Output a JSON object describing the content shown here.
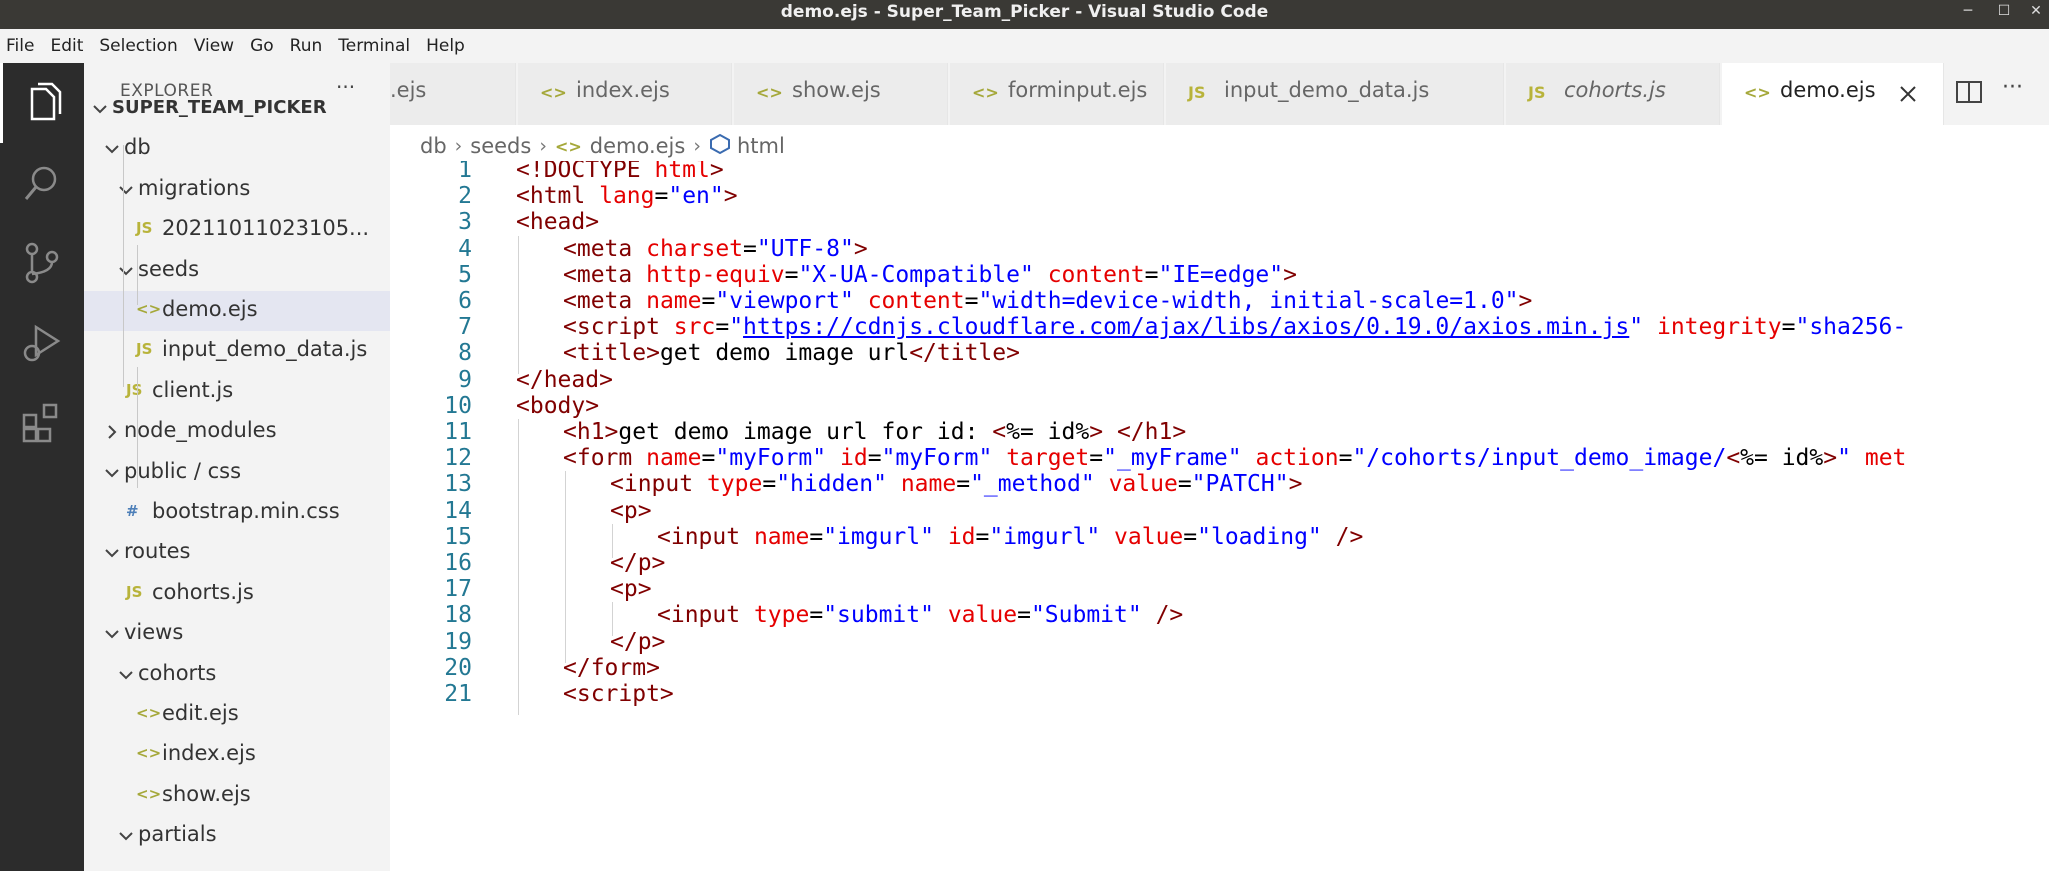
{
  "window": {
    "title": "demo.ejs - Super_Team_Picker - Visual Studio Code"
  },
  "menu": [
    "File",
    "Edit",
    "Selection",
    "View",
    "Go",
    "Run",
    "Terminal",
    "Help"
  ],
  "activity": [
    {
      "name": "explorer-icon"
    },
    {
      "name": "search-icon"
    },
    {
      "name": "source-control-icon"
    },
    {
      "name": "run-debug-icon"
    },
    {
      "name": "extensions-icon"
    }
  ],
  "explorer": {
    "title": "EXPLORER",
    "more": "···",
    "tree": [
      {
        "label": "SUPER_TEAM_PICKER",
        "kind": "root",
        "depth": 0,
        "open": true
      },
      {
        "label": "db",
        "kind": "folder",
        "depth": 1,
        "open": true
      },
      {
        "label": "migrations",
        "kind": "folder",
        "depth": 2,
        "open": true
      },
      {
        "label": "20211011023105...",
        "kind": "js",
        "depth": 3
      },
      {
        "label": "seeds",
        "kind": "folder",
        "depth": 2,
        "open": true
      },
      {
        "label": "demo.ejs",
        "kind": "ejs",
        "depth": 3,
        "selected": true
      },
      {
        "label": "input_demo_data.js",
        "kind": "js",
        "depth": 3
      },
      {
        "label": "client.js",
        "kind": "js",
        "depth": 2
      },
      {
        "label": "node_modules",
        "kind": "folder",
        "depth": 1,
        "open": false
      },
      {
        "label": "public / css",
        "kind": "folder",
        "depth": 1,
        "open": true
      },
      {
        "label": "bootstrap.min.css",
        "kind": "css",
        "depth": 2
      },
      {
        "label": "routes",
        "kind": "folder",
        "depth": 1,
        "open": true
      },
      {
        "label": "cohorts.js",
        "kind": "js",
        "depth": 2
      },
      {
        "label": "views",
        "kind": "folder",
        "depth": 1,
        "open": true
      },
      {
        "label": "cohorts",
        "kind": "folder",
        "depth": 2,
        "open": true
      },
      {
        "label": "edit.ejs",
        "kind": "ejs",
        "depth": 3
      },
      {
        "label": "index.ejs",
        "kind": "ejs",
        "depth": 3
      },
      {
        "label": "show.ejs",
        "kind": "ejs",
        "depth": 3
      },
      {
        "label": "partials",
        "kind": "folder",
        "depth": 2,
        "open": true
      }
    ]
  },
  "tabs": [
    {
      "label": ".ejs",
      "kind": "none"
    },
    {
      "label": "index.ejs",
      "kind": "ejs"
    },
    {
      "label": "show.ejs",
      "kind": "ejs"
    },
    {
      "label": "forminput.ejs",
      "kind": "ejs"
    },
    {
      "label": "input_demo_data.js",
      "kind": "js"
    },
    {
      "label": "cohorts.js",
      "kind": "js",
      "italic": true
    },
    {
      "label": "demo.ejs",
      "kind": "ejs",
      "active": true
    }
  ],
  "icon_glyphs": {
    "js": "JS",
    "ejs": "<>",
    "css": "#"
  },
  "breadcrumb": [
    "db",
    "seeds",
    "demo.ejs",
    "html"
  ],
  "code": [
    {
      "n": "1",
      "indent": 0,
      "t": [
        [
          "tag",
          "<!DOCTYPE "
        ],
        [
          "attr",
          "html"
        ],
        [
          "tag",
          ">"
        ]
      ]
    },
    {
      "n": "2",
      "indent": 0,
      "t": [
        [
          "tag",
          "<html "
        ],
        [
          "attr",
          "lang"
        ],
        [
          "txt",
          "="
        ],
        [
          "str",
          "\"en\""
        ],
        [
          "tag",
          ">"
        ]
      ]
    },
    {
      "n": "3",
      "indent": 0,
      "t": [
        [
          "tag",
          "<head>"
        ]
      ]
    },
    {
      "n": "4",
      "indent": 1,
      "t": [
        [
          "tag",
          "<meta "
        ],
        [
          "attr",
          "charset"
        ],
        [
          "txt",
          "="
        ],
        [
          "str",
          "\"UTF-8\""
        ],
        [
          "tag",
          ">"
        ]
      ]
    },
    {
      "n": "5",
      "indent": 1,
      "t": [
        [
          "tag",
          "<meta "
        ],
        [
          "attr",
          "http-equiv"
        ],
        [
          "txt",
          "="
        ],
        [
          "str",
          "\"X-UA-Compatible\""
        ],
        [
          "txt",
          " "
        ],
        [
          "attr",
          "content"
        ],
        [
          "txt",
          "="
        ],
        [
          "str",
          "\"IE=edge\""
        ],
        [
          "tag",
          ">"
        ]
      ]
    },
    {
      "n": "6",
      "indent": 1,
      "t": [
        [
          "tag",
          "<meta "
        ],
        [
          "attr",
          "name"
        ],
        [
          "txt",
          "="
        ],
        [
          "str",
          "\"viewport\""
        ],
        [
          "txt",
          " "
        ],
        [
          "attr",
          "content"
        ],
        [
          "txt",
          "="
        ],
        [
          "str",
          "\"width=device-width, initial-scale=1.0\""
        ],
        [
          "tag",
          ">"
        ]
      ]
    },
    {
      "n": "7",
      "indent": 1,
      "t": [
        [
          "tag",
          "<script "
        ],
        [
          "attr",
          "src"
        ],
        [
          "txt",
          "="
        ],
        [
          "str",
          "\""
        ],
        [
          "link",
          "https://cdnjs.cloudflare.com/ajax/libs/axios/0.19.0/axios.min.js"
        ],
        [
          "str",
          "\""
        ],
        [
          "txt",
          " "
        ],
        [
          "attr",
          "integrity"
        ],
        [
          "txt",
          "="
        ],
        [
          "str",
          "\"sha256-"
        ]
      ]
    },
    {
      "n": "8",
      "indent": 1,
      "t": [
        [
          "tag",
          "<title>"
        ],
        [
          "txt",
          "get demo image url"
        ],
        [
          "tag",
          "</title>"
        ]
      ]
    },
    {
      "n": "9",
      "indent": 0,
      "t": [
        [
          "tag",
          "</head>"
        ]
      ]
    },
    {
      "n": "10",
      "indent": 0,
      "t": [
        [
          "tag",
          "<body>"
        ]
      ]
    },
    {
      "n": "11",
      "indent": 1,
      "t": [
        [
          "tag",
          "<h1>"
        ],
        [
          "txt",
          "get demo image url for id: "
        ],
        [
          "tag",
          "<"
        ],
        [
          "txt",
          "%= id%"
        ],
        [
          "tag",
          ">"
        ],
        [
          "txt",
          " "
        ],
        [
          "tag",
          "</h1>"
        ]
      ]
    },
    {
      "n": "12",
      "indent": 1,
      "t": [
        [
          "tag",
          "<form "
        ],
        [
          "attr",
          "name"
        ],
        [
          "txt",
          "="
        ],
        [
          "str",
          "\"myForm\""
        ],
        [
          "txt",
          " "
        ],
        [
          "attr",
          "id"
        ],
        [
          "txt",
          "="
        ],
        [
          "str",
          "\"myForm\""
        ],
        [
          "txt",
          " "
        ],
        [
          "attr",
          "target"
        ],
        [
          "txt",
          "="
        ],
        [
          "str",
          "\"_myFrame\""
        ],
        [
          "txt",
          " "
        ],
        [
          "attr",
          "action"
        ],
        [
          "txt",
          "="
        ],
        [
          "str",
          "\"/cohorts/input_demo_image/"
        ],
        [
          "tag",
          "<"
        ],
        [
          "txt",
          "%= id%"
        ],
        [
          "tag",
          ">"
        ],
        [
          "str",
          "\""
        ],
        [
          "txt",
          " "
        ],
        [
          "attr",
          "met"
        ]
      ]
    },
    {
      "n": "13",
      "indent": 2,
      "t": [
        [
          "tag",
          "<input "
        ],
        [
          "attr",
          "type"
        ],
        [
          "txt",
          "="
        ],
        [
          "str",
          "\"hidden\""
        ],
        [
          "txt",
          " "
        ],
        [
          "attr",
          "name"
        ],
        [
          "txt",
          "="
        ],
        [
          "str",
          "\"_method\""
        ],
        [
          "txt",
          " "
        ],
        [
          "attr",
          "value"
        ],
        [
          "txt",
          "="
        ],
        [
          "str",
          "\"PATCH\""
        ],
        [
          "tag",
          ">"
        ]
      ]
    },
    {
      "n": "14",
      "indent": 2,
      "t": [
        [
          "tag",
          "<p>"
        ]
      ]
    },
    {
      "n": "15",
      "indent": 3,
      "t": [
        [
          "tag",
          "<input "
        ],
        [
          "attr",
          "name"
        ],
        [
          "txt",
          "="
        ],
        [
          "str",
          "\"imgurl\""
        ],
        [
          "txt",
          " "
        ],
        [
          "attr",
          "id"
        ],
        [
          "txt",
          "="
        ],
        [
          "str",
          "\"imgurl\""
        ],
        [
          "txt",
          " "
        ],
        [
          "attr",
          "value"
        ],
        [
          "txt",
          "="
        ],
        [
          "str",
          "\"loading\""
        ],
        [
          "txt",
          " "
        ],
        [
          "tag",
          "/>"
        ]
      ]
    },
    {
      "n": "16",
      "indent": 2,
      "t": [
        [
          "tag",
          "</p>"
        ]
      ]
    },
    {
      "n": "17",
      "indent": 2,
      "t": [
        [
          "tag",
          "<p>"
        ]
      ]
    },
    {
      "n": "18",
      "indent": 3,
      "t": [
        [
          "tag",
          "<input "
        ],
        [
          "attr",
          "type"
        ],
        [
          "txt",
          "="
        ],
        [
          "str",
          "\"submit\""
        ],
        [
          "txt",
          " "
        ],
        [
          "attr",
          "value"
        ],
        [
          "txt",
          "="
        ],
        [
          "str",
          "\"Submit\""
        ],
        [
          "txt",
          " "
        ],
        [
          "tag",
          "/>"
        ]
      ]
    },
    {
      "n": "19",
      "indent": 2,
      "t": [
        [
          "tag",
          "</p>"
        ]
      ]
    },
    {
      "n": "20",
      "indent": 1,
      "t": [
        [
          "tag",
          "</form>"
        ]
      ]
    },
    {
      "n": "21",
      "indent": 1,
      "t": [
        [
          "tag",
          "<script>"
        ]
      ]
    }
  ],
  "colors": {
    "ejs_icon": "#a5a83a",
    "js_icon": "#b8b33a",
    "css_icon": "#4d7fb8"
  }
}
